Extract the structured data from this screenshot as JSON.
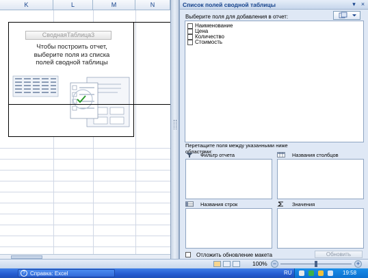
{
  "sheet": {
    "columns": [
      {
        "label": "K",
        "selected": false
      },
      {
        "label": "L",
        "selected": false
      },
      {
        "label": "M",
        "selected": false
      },
      {
        "label": "N",
        "selected": false
      }
    ],
    "pivot_placeholder": {
      "title": "СводнаяТаблица3",
      "hint_line1": "Чтобы построить отчет,",
      "hint_line2": "выберите поля из списка",
      "hint_line3": "полей сводной таблицы"
    }
  },
  "field_list": {
    "title": "Список полей сводной таблицы",
    "choose_label": "Выберите поля для добавления в отчет:",
    "fields": [
      {
        "label": "Наименование",
        "checked": false
      },
      {
        "label": "Цена",
        "checked": false
      },
      {
        "label": "Количество",
        "checked": false
      },
      {
        "label": "Стоимость",
        "checked": false
      }
    ],
    "drag_label_line1": "Перетащите поля между указанными ниже",
    "drag_label_line2": "областями:",
    "areas": {
      "report_filter": "Фильтр отчета",
      "column_labels": "Названия столбцов",
      "row_labels": "Названия строк",
      "values": "Значения"
    },
    "defer_update_label": "Отложить обновление макета",
    "update_button": "Обновить"
  },
  "status_bar": {
    "zoom": "100%",
    "zoom_minus": "−",
    "zoom_plus": "+"
  },
  "taskbar": {
    "task_label": "Справка: Excel",
    "language": "RU",
    "clock": "19:58"
  },
  "colors": {
    "accent": "#15428b",
    "pane_bg": "#dfe8f5",
    "selected_column": "#f1c15f",
    "taskbar": "#245bd0"
  }
}
